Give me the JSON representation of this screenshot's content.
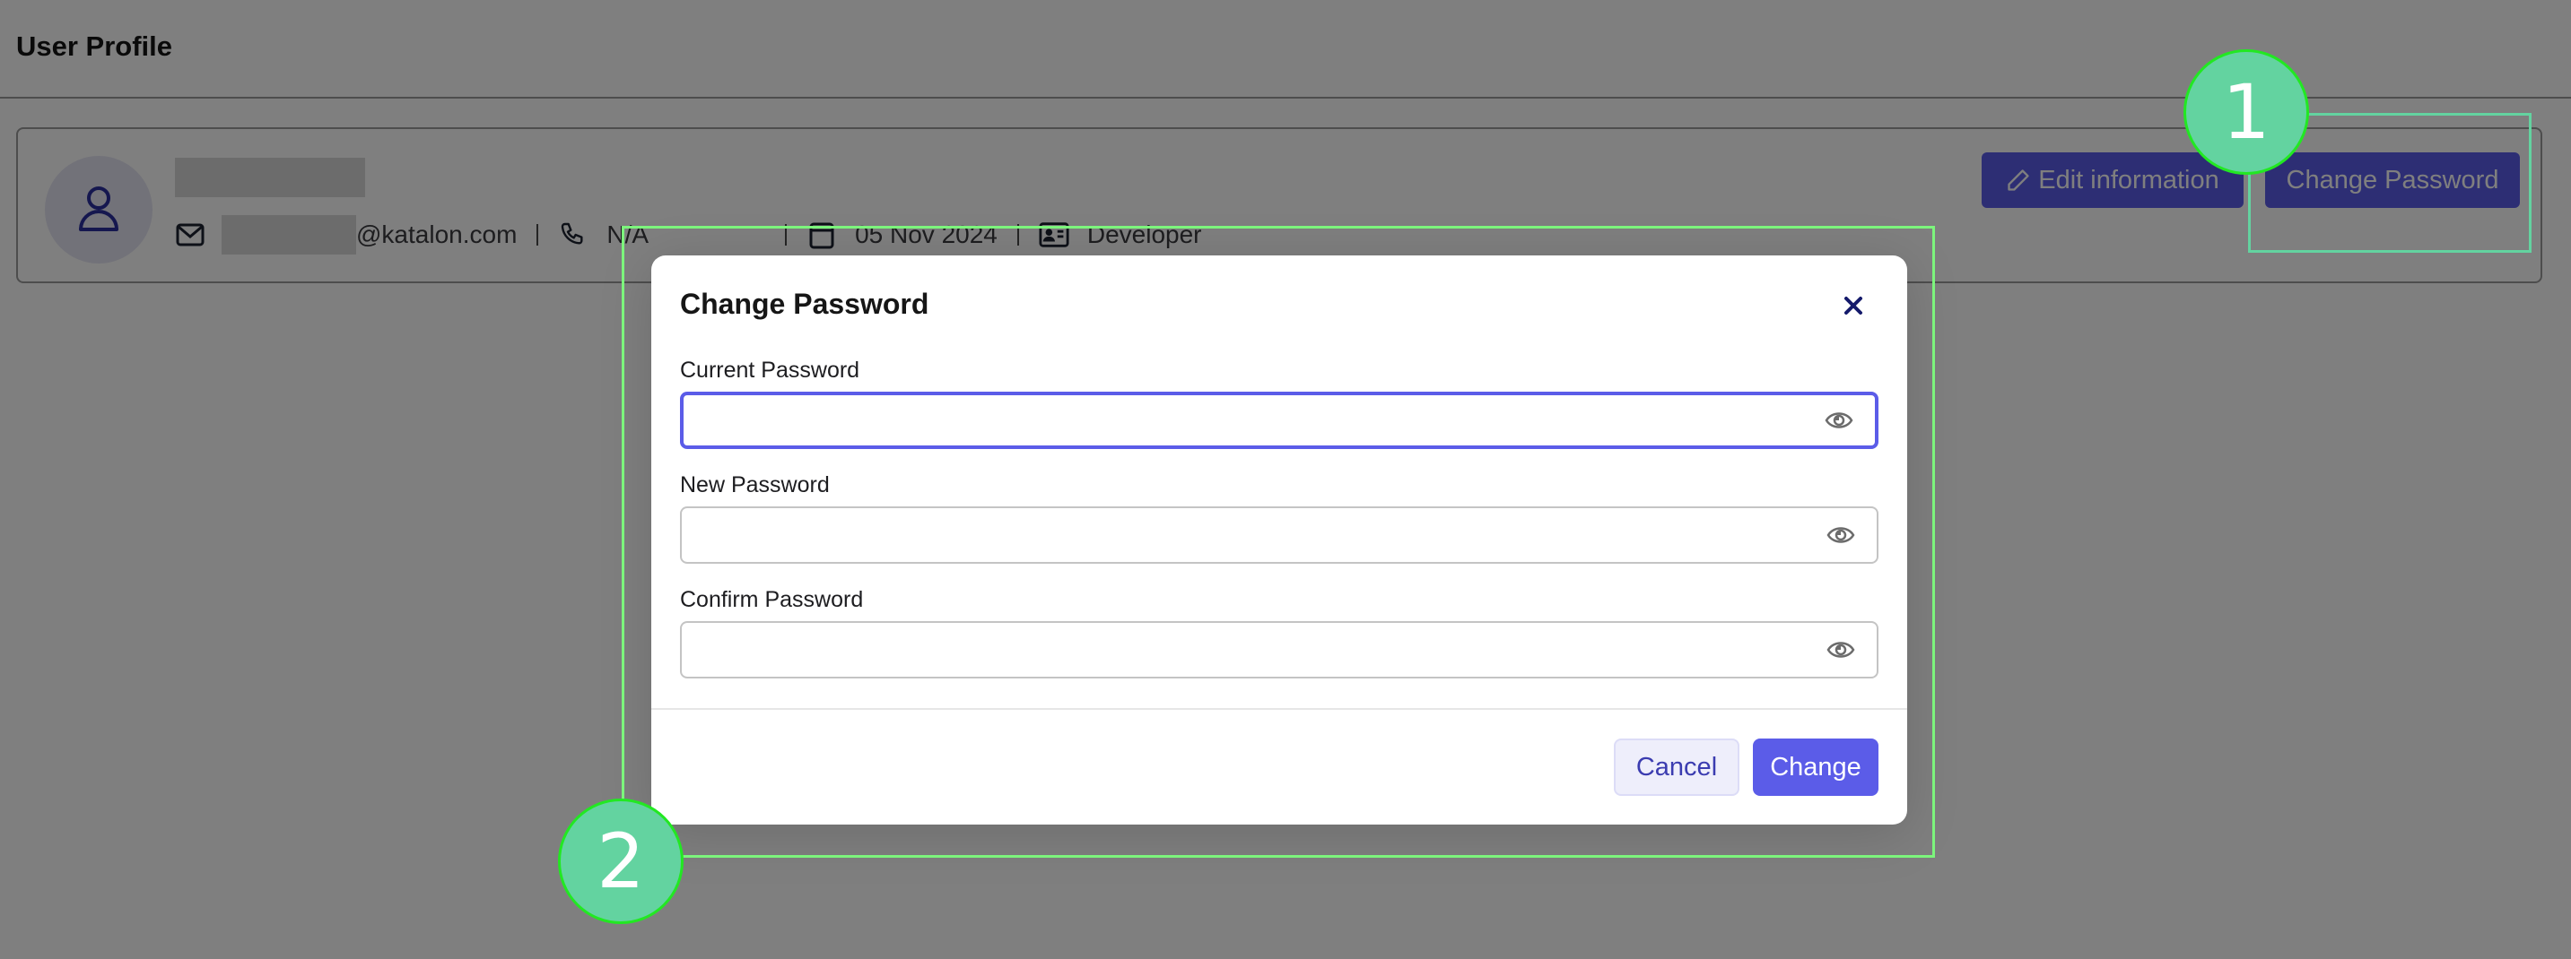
{
  "page": {
    "title": "User Profile"
  },
  "profile": {
    "name_redacted": true,
    "email_domain": "@katalon.com",
    "phone": "N/A",
    "joined_date": "05 Nov 2024",
    "role": "Developer",
    "icons": {
      "avatar": "user-icon",
      "email": "mail-icon",
      "phone": "phone-icon",
      "date": "calendar-icon",
      "role": "id-card-icon",
      "edit": "pencil-icon"
    },
    "actions": {
      "edit_label": "Edit information",
      "change_password_label": "Change Password"
    }
  },
  "dialog": {
    "title": "Change Password",
    "close_icon": "close-icon",
    "fields": [
      {
        "label": "Current Password",
        "value": "",
        "placeholder": "",
        "type": "password",
        "focused": true,
        "toggle_icon": "eye-icon"
      },
      {
        "label": "New Password",
        "value": "",
        "placeholder": "",
        "type": "password",
        "focused": false,
        "toggle_icon": "eye-icon"
      },
      {
        "label": "Confirm Password",
        "value": "",
        "placeholder": "",
        "type": "password",
        "focused": false,
        "toggle_icon": "eye-icon"
      }
    ],
    "cancel_label": "Cancel",
    "submit_label": "Change"
  },
  "annotations": [
    {
      "label": "1",
      "target": "Change Password button"
    },
    {
      "label": "2",
      "target": "Change Password dialog"
    }
  ],
  "colors": {
    "accent": "#5b5ce8",
    "annotation_green": "#63d3a0",
    "annotation_outline": "#22e822"
  }
}
